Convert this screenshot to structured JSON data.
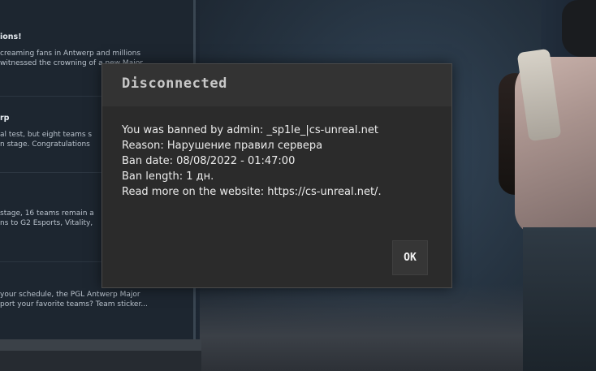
{
  "news": {
    "items": [
      {
        "title": "ions!",
        "lines": [
          "creaming fans in Antwerp and millions",
          "witnessed the crowning of a new Major"
        ]
      },
      {
        "title": "rp",
        "lines": [
          "al test, but eight teams s",
          "n stage. Congratulations"
        ]
      },
      {
        "title": "",
        "lines": [
          "stage, 16 teams remain a",
          "ns to G2 Esports, Vitality,"
        ]
      },
      {
        "title": "",
        "lines": [
          "your schedule, the PGL Antwerp Major",
          "port your favorite teams? Team sticker..."
        ]
      }
    ]
  },
  "dialog": {
    "title": "Disconnected",
    "lines": [
      "You was banned by admin: _sp1le_|cs-unreal.net",
      "Reason: Нарушение правил сервера",
      "Ban date: 08/08/2022 - 01:47:00",
      "Ban length: 1 дн.",
      "Read more on the website: https://cs-unreal.net/."
    ],
    "ok_label": "OK"
  }
}
